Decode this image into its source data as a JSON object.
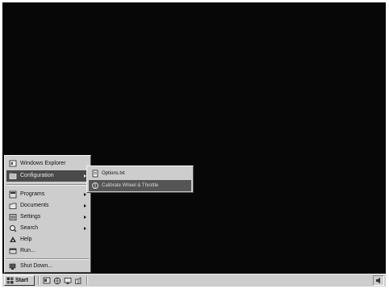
{
  "start_menu": {
    "items": [
      {
        "label": "Windows Explorer",
        "icon": "windows-explorer-icon",
        "submenu": false
      },
      {
        "label": "Configuration",
        "icon": "configuration-folder-icon",
        "submenu": true,
        "highlighted": true
      },
      {
        "label": "Programs",
        "icon": "programs-icon",
        "submenu": true
      },
      {
        "label": "Documents",
        "icon": "documents-icon",
        "submenu": true
      },
      {
        "label": "Settings",
        "icon": "settings-icon",
        "submenu": true
      },
      {
        "label": "Search",
        "icon": "search-icon",
        "submenu": true
      },
      {
        "label": "Help",
        "icon": "help-icon",
        "submenu": false
      },
      {
        "label": "Run...",
        "icon": "run-icon",
        "submenu": false
      },
      {
        "label": "Shut Down...",
        "icon": "shut-down-icon",
        "submenu": false
      }
    ]
  },
  "submenu": {
    "items": [
      {
        "label": "Options.txt",
        "icon": "text-file-icon"
      },
      {
        "label": "Calibrate Wheel & Throttle",
        "icon": "calibrate-icon",
        "highlighted": true
      }
    ]
  },
  "taskbar": {
    "start_label": "Start",
    "quick_launch": [
      "explorer-icon",
      "internet-icon",
      "desktop-icon",
      "volume-icon"
    ],
    "tray_icon": "speaker-icon"
  },
  "colors": {
    "desktop": "#070707",
    "menu_face": "#cdcdcd",
    "highlight": "#4a4a4a"
  }
}
